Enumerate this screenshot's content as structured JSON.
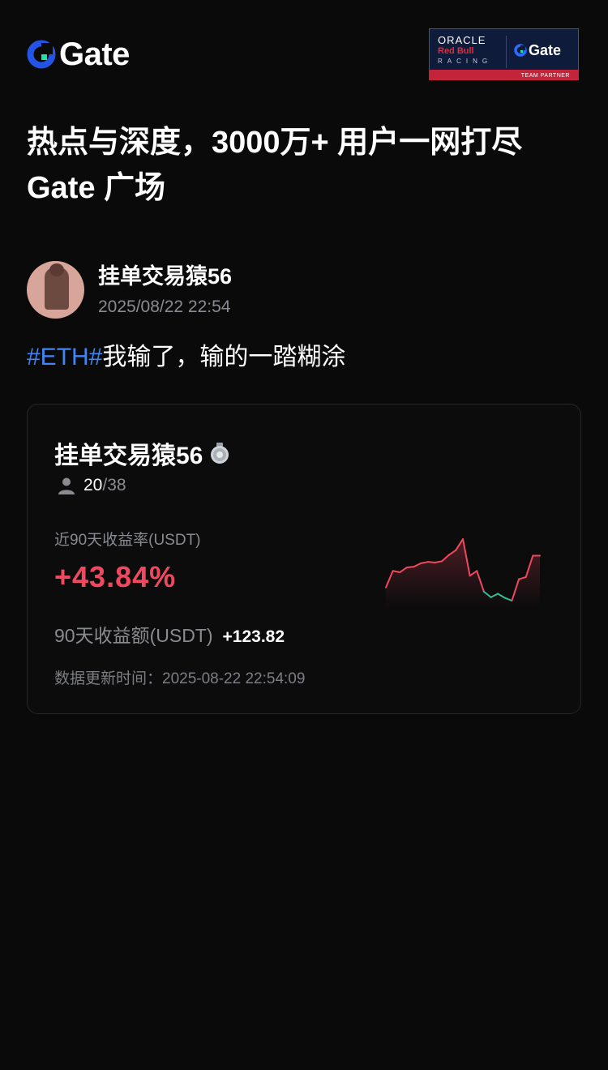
{
  "header": {
    "brand": "Gate",
    "partner": {
      "line1": "ORACLE",
      "line2": "Red Bull",
      "line3": "RACING",
      "brand": "Gate",
      "caption": "TEAM PARTNER"
    }
  },
  "headline": "热点与深度，3000万+ 用户一网打尽 Gate 广场",
  "post": {
    "author": "挂单交易猿56",
    "timestamp": "2025/08/22 22:54",
    "hashtag": "#ETH#",
    "text": "我输了，输的一踏糊涂"
  },
  "card": {
    "name": "挂单交易猿56",
    "medal_icon": "silver-medal-icon",
    "followers_current": "20",
    "followers_total": "/38",
    "roi_label": "近90天收益率(USDT)",
    "roi_value": "+43.84%",
    "pnl_label": "90天收益额(USDT)",
    "pnl_value": "+123.82",
    "updated": "数据更新时间：2025-08-22 22:54:09"
  },
  "colors": {
    "background": "#0a0a0b",
    "hashtag": "#3f85f5",
    "positive": "#f0485e",
    "negative": "#2fbf95",
    "brand_blue": "#2354e6",
    "brand_green": "#17e6a1"
  },
  "chart_data": {
    "type": "line",
    "series": [
      {
        "values": [
          0.18,
          0.42,
          0.4,
          0.47,
          0.48,
          0.53,
          0.55,
          0.54,
          0.56,
          0.65,
          0.72,
          0.88,
          0.35,
          0.42,
          0.12,
          0.04,
          0.09,
          0.03,
          -0.01,
          0.3,
          0.33,
          0.64,
          0.64
        ]
      }
    ]
  }
}
